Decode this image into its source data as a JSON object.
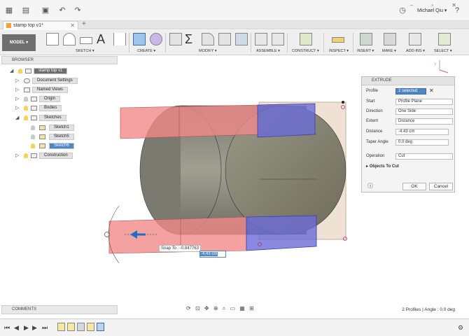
{
  "window": {
    "user_name": "Michael Qiu ▾",
    "tab_title": "stamp top v1*",
    "win_buttons": "–  ▫  ✕"
  },
  "toolbar": {
    "model_label": "MODEL ▾",
    "groups": [
      {
        "label": "SKETCH ▾"
      },
      {
        "label": "CREATE ▾"
      },
      {
        "label": "MODIFY ▾"
      },
      {
        "label": "ASSEMBLE ▾"
      },
      {
        "label": "CONSTRUCT ▾"
      },
      {
        "label": "INSPECT ▾"
      },
      {
        "label": "INSERT ▾"
      },
      {
        "label": "MAKE ▾"
      },
      {
        "label": "ADD-INS ▾"
      },
      {
        "label": "SELECT ▾"
      }
    ]
  },
  "browser": {
    "header": "BROWSER",
    "root": "stamp top v1",
    "items": [
      {
        "label": "Document Settings"
      },
      {
        "label": "Named Views"
      },
      {
        "label": "Origin"
      },
      {
        "label": "Bodies"
      },
      {
        "label": "Sketches"
      },
      {
        "label": "Sketch1"
      },
      {
        "label": "Sketch5"
      },
      {
        "label": "Sketch6"
      },
      {
        "label": "Construction"
      }
    ]
  },
  "extrude": {
    "title": "EXTRUDE",
    "profile_label": "Profile",
    "profile_value": "2 selected",
    "start_label": "Start",
    "start_value": "Profile Plane",
    "direction_label": "Direction",
    "direction_value": "One Side",
    "extent_label": "Extent",
    "extent_value": "Distance",
    "distance_label": "Distance",
    "distance_value": "-4.43 cm",
    "taper_label": "Taper Angle",
    "taper_value": "0.0 deg",
    "operation_label": "Operation",
    "operation_value": "Cut",
    "objects_to_cut": "Objects To Cut",
    "ok": "OK",
    "cancel": "Cancel"
  },
  "viewport": {
    "snap_tip": "Snap To : -0.847763",
    "distance_input": "-4.43 cm"
  },
  "comments": {
    "label": "COMMENTS"
  },
  "status": {
    "text": "2 Profiles | Angle : 0.0 deg"
  },
  "colors": {
    "cut_face": "#f08a8a",
    "selected_face": "#6b6bd8",
    "body": "#8f8f85",
    "profile_plane": "#e6d2bd",
    "accent": "#4f86c6"
  }
}
